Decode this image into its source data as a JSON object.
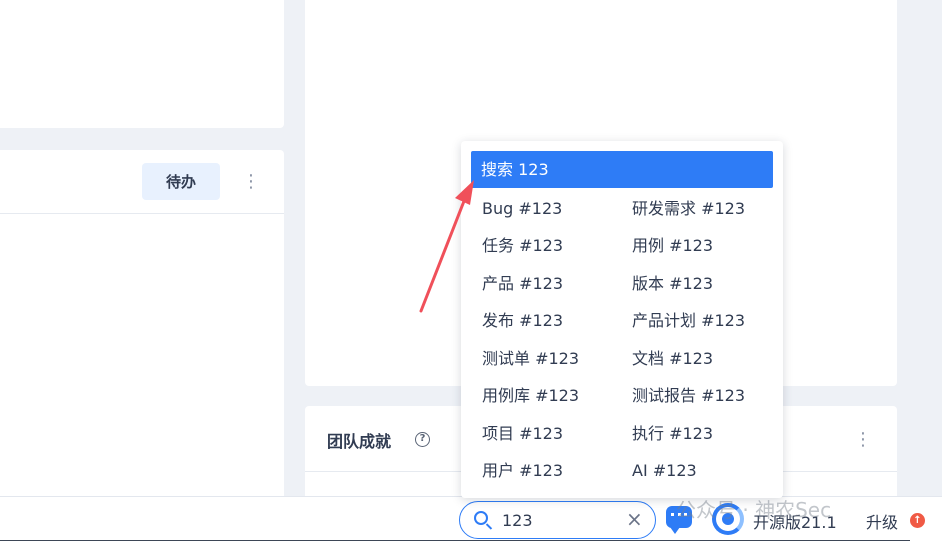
{
  "todo_card": {
    "todo_button": "待办",
    "more": "⋮"
  },
  "team_card": {
    "title": "团队成就",
    "help": "?",
    "more": "⋮"
  },
  "search_dropdown": {
    "active": "搜索 123",
    "items": [
      "Bug #123",
      "研发需求 #123",
      "任务 #123",
      "用例 #123",
      "产品 #123",
      "版本 #123",
      "发布 #123",
      "产品计划 #123",
      "测试单 #123",
      "文档 #123",
      "用例库 #123",
      "测试报告 #123",
      "项目 #123",
      "执行 #123",
      "用户 #123",
      "AI #123"
    ]
  },
  "search": {
    "value": "123",
    "clear": "×"
  },
  "bottom_bar": {
    "version": "开源版21.1",
    "upgrade": "升级",
    "upgrade_badge": "↑"
  },
  "watermark": "公众号 · 神农Sec",
  "colors": {
    "accent": "#2e7cf6",
    "annotation": "#f0505a"
  }
}
